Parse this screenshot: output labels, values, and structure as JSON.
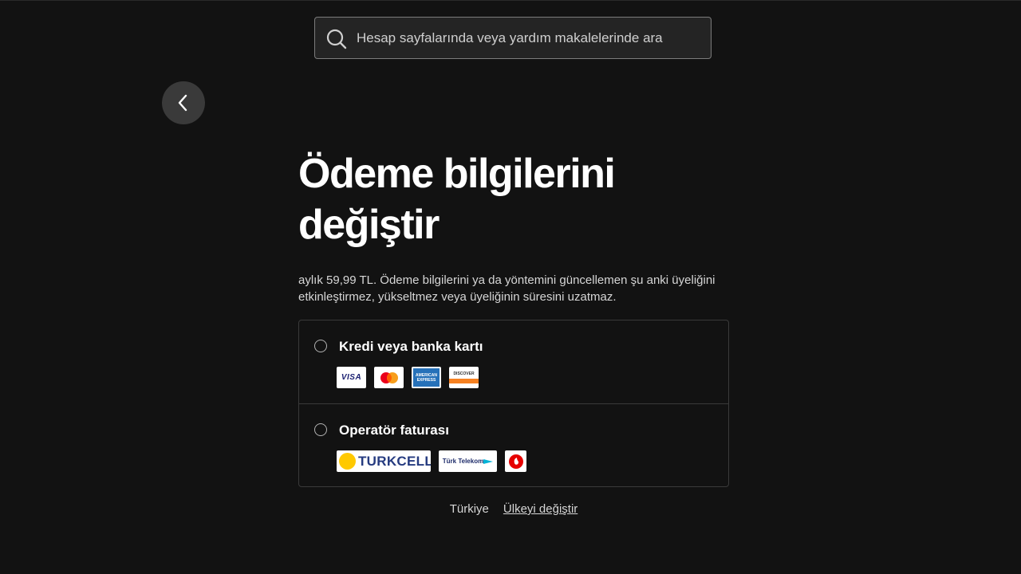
{
  "search": {
    "placeholder": "Hesap sayfalarında veya yardım makalelerinde ara",
    "icon": "search-icon"
  },
  "nav": {
    "back_icon": "chevron-left-icon"
  },
  "page": {
    "title": "Ödeme bilgilerini değiştir",
    "description": "aylık 59,99 TL. Ödeme bilgilerini ya da yöntemini güncellemen şu anki üyeliğini etkinleştirmez, yükseltmez veya üyeliğinin süresini uzatmaz."
  },
  "payment_options": [
    {
      "label": "Kredi veya banka kartı",
      "logos": [
        "VISA",
        "Mastercard",
        "AMERICAN EXPRESS",
        "DISCOVER"
      ]
    },
    {
      "label": "Operatör faturası",
      "logos": [
        "TURKCELL",
        "Türk Telekom",
        "Vodafone"
      ]
    }
  ],
  "footer": {
    "country": "Türkiye",
    "change_country": "Ülkeyi değiştir"
  },
  "colors": {
    "background": "#121212",
    "text": "#ffffff",
    "muted_text": "#d6d6d6",
    "border": "#3a3a3a",
    "button_bg": "#3a3a3a"
  }
}
